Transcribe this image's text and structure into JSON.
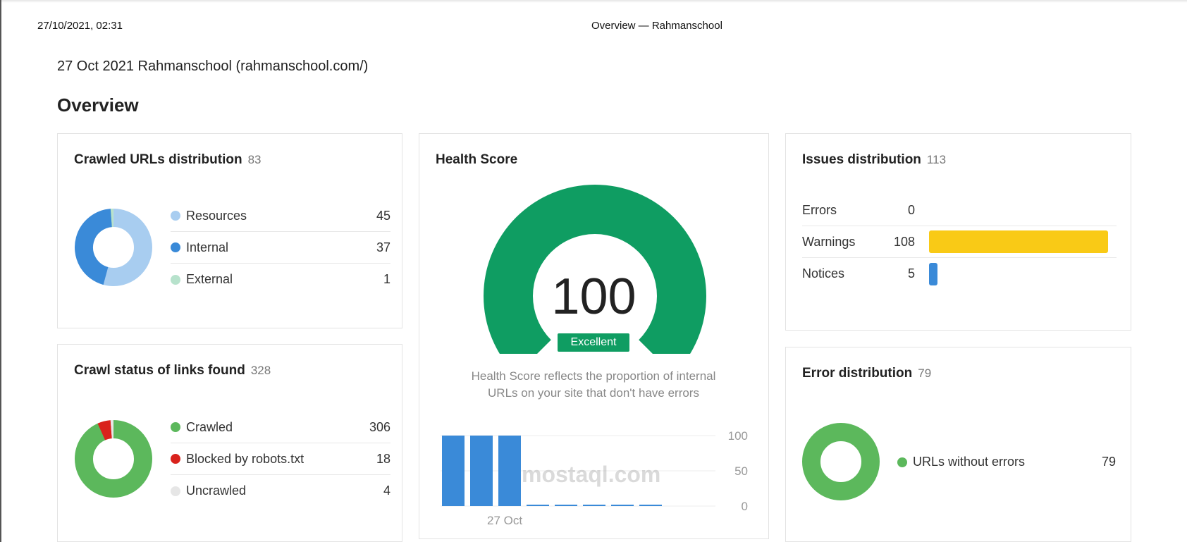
{
  "print_header": {
    "date": "27/10/2021, 02:31",
    "title": "Overview — Rahmanschool"
  },
  "report": {
    "subtitle": "27 Oct 2021 Rahmanschool (rahmanschool.com/)",
    "heading": "Overview"
  },
  "crawled_urls": {
    "title": "Crawled URLs distribution",
    "count": "83",
    "items": [
      {
        "label": "Resources",
        "value": "45",
        "color": "#a8cdf0"
      },
      {
        "label": "Internal",
        "value": "37",
        "color": "#3a8ad8"
      },
      {
        "label": "External",
        "value": "1",
        "color": "#b7e2cc"
      }
    ]
  },
  "crawl_status": {
    "title": "Crawl status of links found",
    "count": "328",
    "items": [
      {
        "label": "Crawled",
        "value": "306",
        "color": "#5cb85c"
      },
      {
        "label": "Blocked by robots.txt",
        "value": "18",
        "color": "#d9221c"
      },
      {
        "label": "Uncrawled",
        "value": "4",
        "color": "#e6e6e6"
      }
    ]
  },
  "health_score": {
    "title": "Health Score",
    "score": "100",
    "score_fraction": 1.0,
    "rating": "Excellent",
    "description_line1": "Health Score reflects the proportion of internal",
    "description_line2": "URLs on your site that don't have errors",
    "history": {
      "values": [
        100,
        100,
        100,
        0,
        0,
        0,
        0,
        0
      ],
      "x_label": "27 Oct",
      "y_ticks": [
        "100",
        "50",
        "0"
      ]
    },
    "color": "#0f9d62"
  },
  "issues": {
    "title": "Issues distribution",
    "count": "113",
    "max": 108,
    "rows": [
      {
        "label": "Errors",
        "value": "0",
        "num": 0,
        "color": "#e74c3c"
      },
      {
        "label": "Warnings",
        "value": "108",
        "num": 108,
        "color": "#f9ca16"
      },
      {
        "label": "Notices",
        "value": "5",
        "num": 5,
        "color": "#3a8ad8"
      }
    ]
  },
  "error_distribution": {
    "title": "Error distribution",
    "count": "79",
    "items": [
      {
        "label": "URLs without errors",
        "value": "79",
        "color": "#5cb85c"
      }
    ]
  },
  "watermark": "mostaql.com"
}
